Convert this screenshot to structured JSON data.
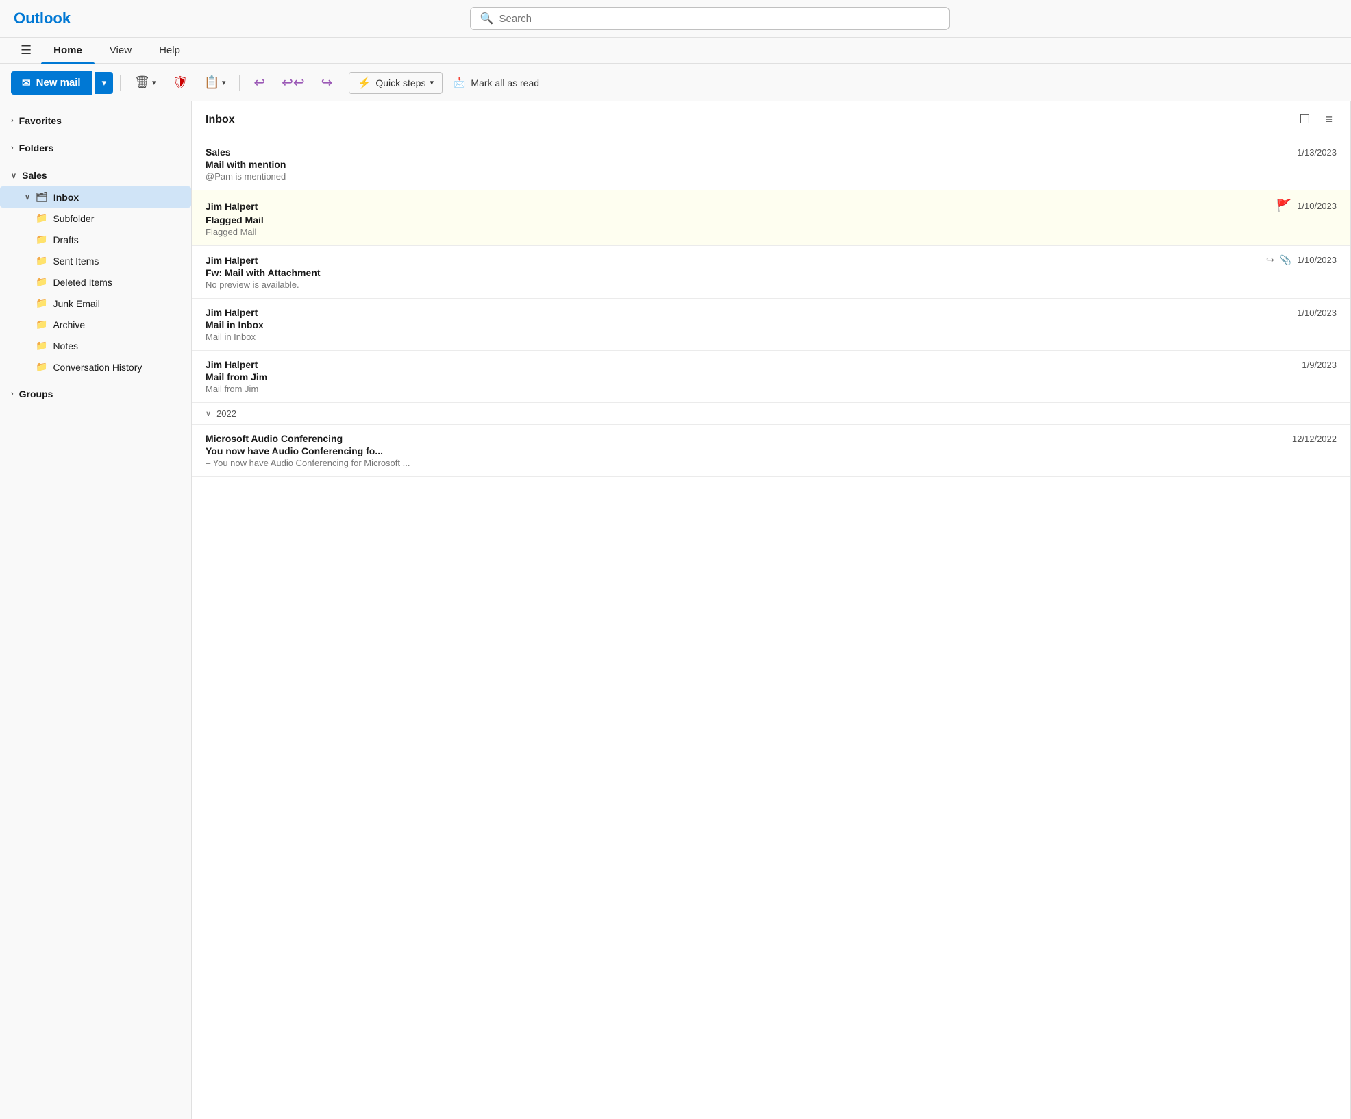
{
  "app": {
    "title": "Outlook"
  },
  "search": {
    "placeholder": "Search"
  },
  "nav": {
    "tabs": [
      {
        "id": "home",
        "label": "Home",
        "active": true
      },
      {
        "id": "view",
        "label": "View",
        "active": false
      },
      {
        "id": "help",
        "label": "Help",
        "active": false
      }
    ]
  },
  "toolbar": {
    "new_mail_label": "New mail",
    "quick_steps_label": "Quick steps",
    "mark_all_read_label": "Mark all as read"
  },
  "sidebar": {
    "favorites_label": "Favorites",
    "folders_label": "Folders",
    "sales_label": "Sales",
    "inbox_label": "Inbox",
    "subfolder_label": "Subfolder",
    "drafts_label": "Drafts",
    "sent_items_label": "Sent Items",
    "deleted_items_label": "Deleted Items",
    "junk_email_label": "Junk Email",
    "archive_label": "Archive",
    "notes_label": "Notes",
    "conversation_history_label": "Conversation History",
    "groups_label": "Groups"
  },
  "email_panel": {
    "title": "Inbox",
    "emails": [
      {
        "id": "e1",
        "sender": "Sales",
        "subject": "Mail with mention",
        "preview": "@Pam is mentioned",
        "date": "1/13/2023",
        "flagged": false,
        "forwarded": false,
        "attachment": false,
        "section": null
      },
      {
        "id": "e2",
        "sender": "Jim Halpert",
        "subject": "Flagged Mail",
        "preview": "Flagged Mail",
        "date": "1/10/2023",
        "flagged": true,
        "forwarded": false,
        "attachment": false,
        "section": null
      },
      {
        "id": "e3",
        "sender": "Jim Halpert",
        "subject": "Fw: Mail with Attachment",
        "preview": "No preview is available.",
        "date": "1/10/2023",
        "flagged": false,
        "forwarded": true,
        "attachment": true,
        "section": null
      },
      {
        "id": "e4",
        "sender": "Jim Halpert",
        "subject": "Mail in Inbox",
        "preview": "Mail in Inbox",
        "date": "1/10/2023",
        "flagged": false,
        "forwarded": false,
        "attachment": false,
        "section": null
      },
      {
        "id": "e5",
        "sender": "Jim Halpert",
        "subject": "Mail from Jim",
        "preview": "Mail from Jim",
        "date": "1/9/2023",
        "flagged": false,
        "forwarded": false,
        "attachment": false,
        "section": null
      },
      {
        "id": "e6",
        "sender": "Microsoft Audio Conferencing",
        "subject": "You now have Audio Conferencing fo...",
        "preview": "– You now have Audio Conferencing for Microsoft ...",
        "date": "12/12/2022",
        "flagged": false,
        "forwarded": false,
        "attachment": false,
        "section": "2022"
      }
    ]
  }
}
